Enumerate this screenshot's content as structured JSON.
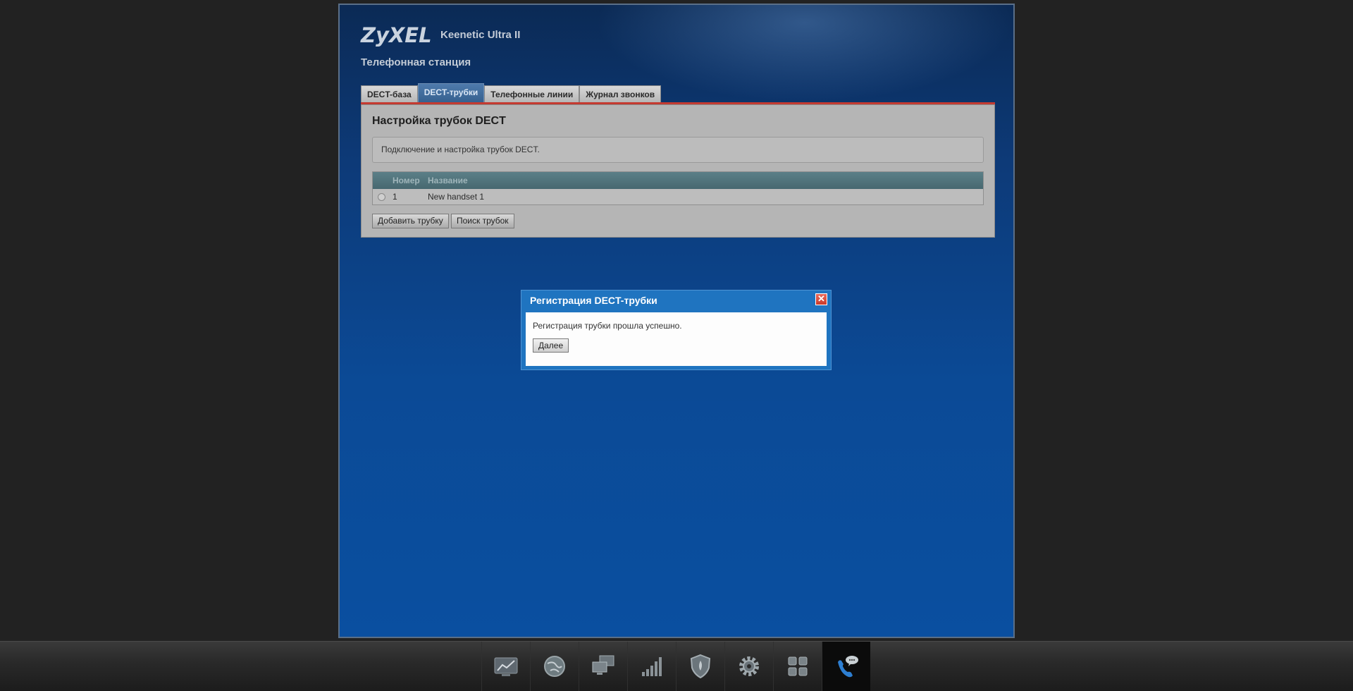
{
  "header": {
    "logo": "ZyXEL",
    "model": "Keenetic Ultra II",
    "section_title": "Телефонная станция"
  },
  "tabs": [
    {
      "label": "DECT-база",
      "active": false
    },
    {
      "label": "DECT-трубки",
      "active": true
    },
    {
      "label": "Телефонные линии",
      "active": false
    },
    {
      "label": "Журнал звонков",
      "active": false
    }
  ],
  "panel": {
    "title": "Настройка трубок DECT",
    "description": "Подключение и настройка трубок DECT.",
    "table": {
      "columns": [
        "Номер",
        "Название"
      ],
      "rows": [
        {
          "number": "1",
          "name": "New handset 1"
        }
      ]
    },
    "buttons": {
      "add": "Добавить трубку",
      "search": "Поиск трубок"
    }
  },
  "dialog": {
    "title": "Регистрация DECT-трубки",
    "message": "Регистрация трубки прошла успешно.",
    "next_button": "Далее"
  },
  "taskbar": {
    "items": [
      {
        "icon": "chart-icon",
        "active": false
      },
      {
        "icon": "globe-icon",
        "active": false
      },
      {
        "icon": "network-computers-icon",
        "active": false
      },
      {
        "icon": "signal-bars-icon",
        "active": false
      },
      {
        "icon": "shield-icon",
        "active": false
      },
      {
        "icon": "gear-icon",
        "active": false
      },
      {
        "icon": "apps-grid-icon",
        "active": false
      },
      {
        "icon": "phone-chat-icon",
        "active": true
      }
    ]
  },
  "colors": {
    "accent_red": "#c43a30",
    "dialog_blue": "#1f74c0",
    "active_tab": "#36618f"
  }
}
